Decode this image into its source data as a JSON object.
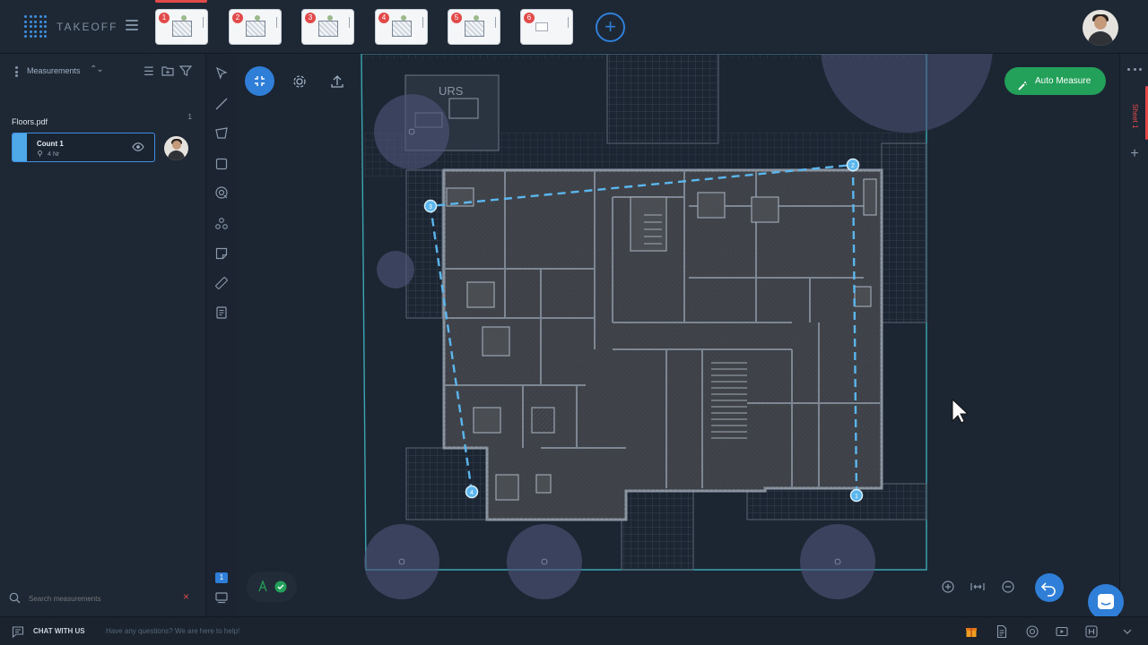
{
  "app": {
    "logo_text": "TAKEOFF"
  },
  "sheets": [
    {
      "number": "1",
      "active": true
    },
    {
      "number": "2",
      "active": false
    },
    {
      "number": "3",
      "active": false
    },
    {
      "number": "4",
      "active": false
    },
    {
      "number": "5",
      "active": false
    },
    {
      "number": "6",
      "active": false
    }
  ],
  "add_sheet_label": "+",
  "left_panel": {
    "title": "Measurements",
    "file": {
      "name": "Floors.pdf",
      "count": "1"
    },
    "measurement": {
      "name": "Count 1",
      "detail": "4 Nr",
      "color": "#4fa8e8"
    },
    "search_placeholder": "Search measurements",
    "clear_label": "×"
  },
  "toolbar": {
    "tools": [
      "select-icon",
      "line-icon",
      "area-icon",
      "rectangle-icon",
      "target-icon",
      "count-icon",
      "note-icon",
      "ruler-icon",
      "legend-icon"
    ],
    "badge": "1"
  },
  "canvas": {
    "auto_measure_label": "Auto Measure",
    "room_label": "URS",
    "points": [
      "1",
      "2",
      "3",
      "4"
    ]
  },
  "right_rail": {
    "sheet_label": "Sheet 1",
    "plus_label": "+"
  },
  "bottombar": {
    "chat_label": "CHAT WITH US",
    "question_text": "Have any questions? We are here to help!"
  },
  "colors": {
    "accent": "#2f7fd8",
    "auto_measure": "#23a05a",
    "measure_line": "#5bb6ee",
    "badge": "#e24a4a"
  }
}
